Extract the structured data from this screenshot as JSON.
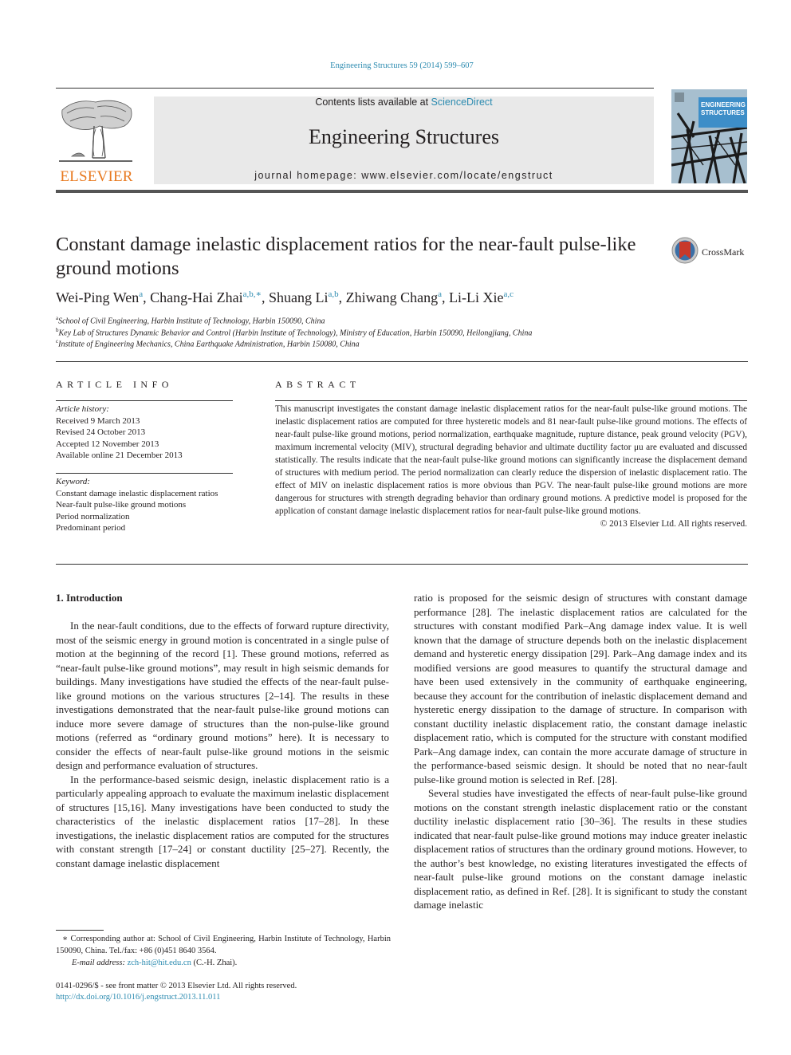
{
  "header": {
    "journal_ref": "Engineering Structures 59 (2014) 599–607",
    "contents_prefix": "Contents lists available at ",
    "contents_link": "ScienceDirect",
    "journal_name": "Engineering Structures",
    "homepage": "journal homepage: www.elsevier.com/locate/engstruct",
    "publisher_logo_text": "ELSEVIER",
    "cover_title_line1": "ENGINEERING",
    "cover_title_line2": "STRUCTURES",
    "crossmark_label": "CrossMark"
  },
  "article": {
    "title": "Constant damage inelastic displacement ratios for the near-fault pulse-like ground motions",
    "authors": [
      {
        "name": "Wei-Ping Wen",
        "sup": "a"
      },
      {
        "name": "Chang-Hai Zhai",
        "sup": "a,b,∗"
      },
      {
        "name": "Shuang Li",
        "sup": "a,b"
      },
      {
        "name": "Zhiwang Chang",
        "sup": "a"
      },
      {
        "name": "Li-Li Xie",
        "sup": "a,c"
      }
    ],
    "affiliations": [
      {
        "mark": "a",
        "text": "School of Civil Engineering, Harbin Institute of Technology, Harbin 150090, China"
      },
      {
        "mark": "b",
        "text": "Key Lab of Structures Dynamic Behavior and Control (Harbin Institute of Technology), Ministry of Education, Harbin 150090, Heilongjiang, China"
      },
      {
        "mark": "c",
        "text": "Institute of Engineering Mechanics, China Earthquake Administration, Harbin 150080, China"
      }
    ]
  },
  "article_info": {
    "heading": "ARTICLE INFO",
    "history_label": "Article history:",
    "history": [
      "Received 9 March 2013",
      "Revised 24 October 2013",
      "Accepted 12 November 2013",
      "Available online 21 December 2013"
    ],
    "keyword_label": "Keyword:",
    "keywords": [
      "Constant damage inelastic displacement ratios",
      "Near-fault pulse-like ground motions",
      "Period normalization",
      "Predominant period"
    ]
  },
  "abstract": {
    "heading": "ABSTRACT",
    "text": "This manuscript investigates the constant damage inelastic displacement ratios for the near-fault pulse-like ground motions. The inelastic displacement ratios are computed for three hysteretic models and 81 near-fault pulse-like ground motions. The effects of near-fault pulse-like ground motions, period normalization, earthquake magnitude, rupture distance, peak ground velocity (PGV), maximum incremental velocity (MIV), structural degrading behavior and ultimate ductility factor μu are evaluated and discussed statistically. The results indicate that the near-fault pulse-like ground motions can significantly increase the displacement demand of structures with medium period. The period normalization can clearly reduce the dispersion of inelastic displacement ratio. The effect of MIV on inelastic displacement ratios is more obvious than PGV. The near-fault pulse-like ground motions are more dangerous for structures with strength degrading behavior than ordinary ground motions. A predictive model is proposed for the application of constant damage inelastic displacement ratios for near-fault pulse-like ground motions.",
    "copyright": "© 2013 Elsevier Ltd. All rights reserved."
  },
  "body": {
    "section_heading": "1. Introduction",
    "left_col": [
      "In the near-fault conditions, due to the effects of forward rupture directivity, most of the seismic energy in ground motion is concentrated in a single pulse of motion at the beginning of the record [1]. These ground motions, referred as “near-fault pulse-like ground motions”, may result in high seismic demands for buildings. Many investigations have studied the effects of the near-fault pulse-like ground motions on the various structures [2–14]. The results in these investigations demonstrated that the near-fault pulse-like ground motions can induce more severe damage of structures than the non-pulse-like ground motions (referred as “ordinary ground motions” here). It is necessary to consider the effects of near-fault pulse-like ground motions in the seismic design and performance evaluation of structures.",
      "In the performance-based seismic design, inelastic displacement ratio is a particularly appealing approach to evaluate the maximum inelastic displacement of structures [15,16]. Many investigations have been conducted to study the characteristics of the inelastic displacement ratios [17–28]. In these investigations, the inelastic displacement ratios are computed for the structures with constant strength [17–24] or constant ductility [25–27]. Recently, the constant damage inelastic displacement"
    ],
    "right_col": [
      "ratio is proposed for the seismic design of structures with constant damage performance [28]. The inelastic displacement ratios are calculated for the structures with constant modified Park–Ang damage index value. It is well known that the damage of structure depends both on the inelastic displacement demand and hysteretic energy dissipation [29]. Park–Ang damage index and its modified versions are good measures to quantify the structural damage and have been used extensively in the community of earthquake engineering, because they account for the contribution of inelastic displacement demand and hysteretic energy dissipation to the damage of structure. In comparison with constant ductility inelastic displacement ratio, the constant damage inelastic displacement ratio, which is computed for the structure with constant modified Park–Ang damage index, can contain the more accurate damage of structure in the performance-based seismic design. It should be noted that no near-fault pulse-like ground motion is selected in Ref. [28].",
      "Several studies have investigated the effects of near-fault pulse-like ground motions on the constant strength inelastic displacement ratio or the constant ductility inelastic displacement ratio [30–36]. The results in these studies indicated that near-fault pulse-like ground motions may induce greater inelastic displacement ratios of structures than the ordinary ground motions. However, to the author’s best knowledge, no existing literatures investigated the effects of near-fault pulse-like ground motions on the constant damage inelastic displacement ratio, as defined in Ref. [28]. It is significant to study the constant damage inelastic"
    ]
  },
  "footnote": {
    "corresponding": "∗ Corresponding author at: School of Civil Engineering, Harbin Institute of Technology, Harbin 150090, China. Tel./fax: +86 (0)451 8640 3564.",
    "email_label": "E-mail address: ",
    "email": "zch-hit@hit.edu.cn",
    "email_suffix": " (C.-H. Zhai).",
    "issn_line": "0141-0296/$ - see front matter © 2013 Elsevier Ltd. All rights reserved.",
    "doi": "http://dx.doi.org/10.1016/j.engstruct.2013.11.011"
  },
  "colors": {
    "link": "#2c8bb0",
    "elsevier_orange": "#e8791f",
    "banner_gray": "#e9e9e9",
    "cover_blue": "#3d8ec8"
  }
}
